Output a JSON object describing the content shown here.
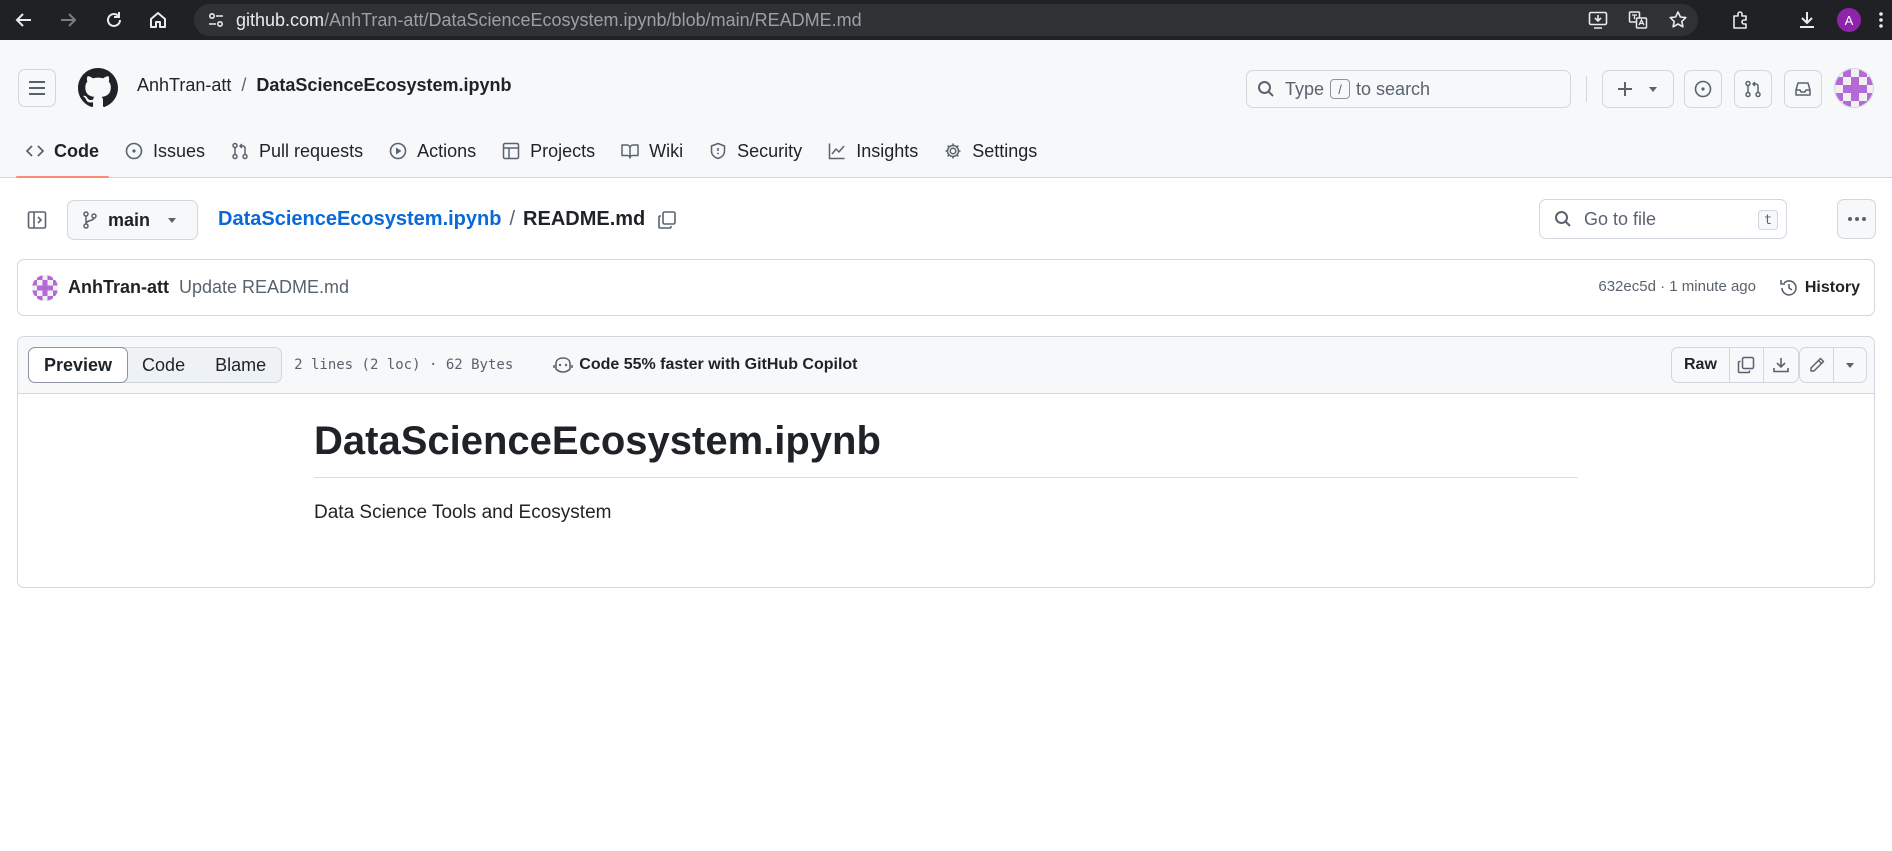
{
  "browser": {
    "url_host": "github.com",
    "url_path": "/AnhTran-att/DataScienceEcosystem.ipynb/blob/main/README.md",
    "profile_initial": "A",
    "profile_color": "#8e24aa"
  },
  "header": {
    "owner": "AnhTran-att",
    "separator": "/",
    "repo": "DataScienceEcosystem.ipynb",
    "search_prefix": "Type",
    "search_key": "/",
    "search_suffix": "to search"
  },
  "tabs": [
    {
      "label": "Code",
      "icon": "code-icon",
      "active": true
    },
    {
      "label": "Issues",
      "icon": "issue-icon"
    },
    {
      "label": "Pull requests",
      "icon": "pull-request-icon"
    },
    {
      "label": "Actions",
      "icon": "play-icon"
    },
    {
      "label": "Projects",
      "icon": "table-icon"
    },
    {
      "label": "Wiki",
      "icon": "book-icon"
    },
    {
      "label": "Security",
      "icon": "shield-icon"
    },
    {
      "label": "Insights",
      "icon": "graph-icon"
    },
    {
      "label": "Settings",
      "icon": "gear-icon"
    }
  ],
  "file_nav": {
    "branch": "main",
    "repo_link": "DataScienceEcosystem.ipynb",
    "path_separator": "/",
    "file_name": "README.md",
    "goto_placeholder": "Go to file",
    "goto_key": "t"
  },
  "commit": {
    "author": "AnhTran-att",
    "message": "Update README.md",
    "meta": "632ec5d · 1 minute ago",
    "history_label": "History"
  },
  "viewer": {
    "modes": [
      "Preview",
      "Code",
      "Blame"
    ],
    "active_mode": "Preview",
    "file_info": "2 lines (2 loc) · 62 Bytes",
    "copilot_text": "Code 55% faster with GitHub Copilot",
    "raw_label": "Raw"
  },
  "readme": {
    "heading": "DataScienceEcosystem.ipynb",
    "paragraph": "Data Science Tools and Ecosystem"
  },
  "colors": {
    "accent_tab_underline": "#fd8c73",
    "link": "#0969da",
    "avatar_pattern": "#b46ad6"
  }
}
